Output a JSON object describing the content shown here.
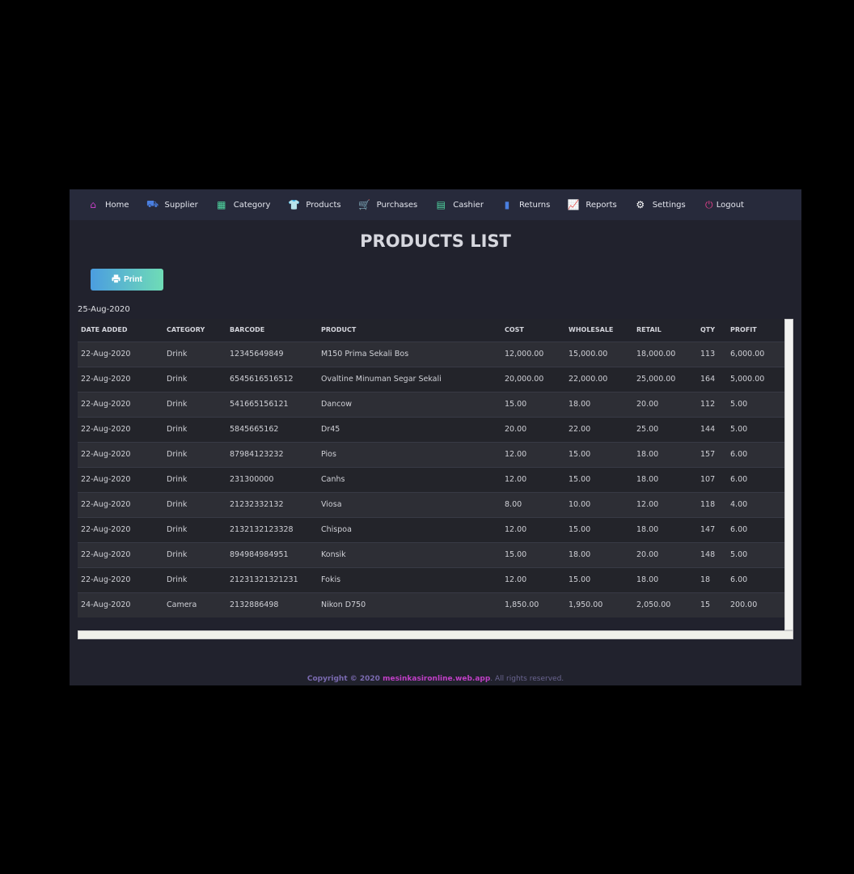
{
  "nav": {
    "items": [
      {
        "label": "Home",
        "icon": "home-icon",
        "color": "#c43fc4"
      },
      {
        "label": "Supplier",
        "icon": "truck-icon",
        "color": "#4a7fe0"
      },
      {
        "label": "Category",
        "icon": "boxes-icon",
        "color": "#4fd6a0"
      },
      {
        "label": "Products",
        "icon": "tshirt-icon",
        "color": "#ffffff"
      },
      {
        "label": "Purchases",
        "icon": "cart-icon",
        "color": "#e0408a"
      },
      {
        "label": "Cashier",
        "icon": "cash-register-icon",
        "color": "#4fd6a0"
      },
      {
        "label": "Returns",
        "icon": "receipt-icon",
        "color": "#4a7fe0"
      },
      {
        "label": "Reports",
        "icon": "chart-line-icon",
        "color": "#e05a6a"
      },
      {
        "label": "Settings",
        "icon": "gear-icon",
        "color": "#ffffff"
      },
      {
        "label": "Logout",
        "icon": "power-icon",
        "color": "#e0408a"
      }
    ]
  },
  "page": {
    "title": "PRODUCTS LIST",
    "print_label": "Print",
    "date": "25-Aug-2020"
  },
  "table": {
    "headers": [
      "DATE ADDED",
      "CATEGORY",
      "BARCODE",
      "PRODUCT",
      "COST",
      "WHOLESALE",
      "RETAIL",
      "QTY",
      "PROFIT"
    ],
    "rows": [
      [
        "22-Aug-2020",
        "Drink",
        "12345649849",
        "M150 Prima Sekali Bos",
        "12,000.00",
        "15,000.00",
        "18,000.00",
        "113",
        "6,000.00"
      ],
      [
        "22-Aug-2020",
        "Drink",
        "6545616516512",
        "Ovaltine Minuman Segar Sekali",
        "20,000.00",
        "22,000.00",
        "25,000.00",
        "164",
        "5,000.00"
      ],
      [
        "22-Aug-2020",
        "Drink",
        "541665156121",
        "Dancow",
        "15.00",
        "18.00",
        "20.00",
        "112",
        "5.00"
      ],
      [
        "22-Aug-2020",
        "Drink",
        "5845665162",
        "Dr45",
        "20.00",
        "22.00",
        "25.00",
        "144",
        "5.00"
      ],
      [
        "22-Aug-2020",
        "Drink",
        "87984123232",
        "Pios",
        "12.00",
        "15.00",
        "18.00",
        "157",
        "6.00"
      ],
      [
        "22-Aug-2020",
        "Drink",
        "231300000",
        "Canhs",
        "12.00",
        "15.00",
        "18.00",
        "107",
        "6.00"
      ],
      [
        "22-Aug-2020",
        "Drink",
        "21232332132",
        "Viosa",
        "8.00",
        "10.00",
        "12.00",
        "118",
        "4.00"
      ],
      [
        "22-Aug-2020",
        "Drink",
        "2132132123328",
        "Chispoa",
        "12.00",
        "15.00",
        "18.00",
        "147",
        "6.00"
      ],
      [
        "22-Aug-2020",
        "Drink",
        "894984984951",
        "Konsik",
        "15.00",
        "18.00",
        "20.00",
        "148",
        "5.00"
      ],
      [
        "22-Aug-2020",
        "Drink",
        "21231321321231",
        "Fokis",
        "12.00",
        "15.00",
        "18.00",
        "18",
        "6.00"
      ],
      [
        "24-Aug-2020",
        "Camera",
        "2132886498",
        "Nikon D750",
        "1,850.00",
        "1,950.00",
        "2,050.00",
        "15",
        "200.00"
      ]
    ]
  },
  "footer": {
    "prefix": "Copyright © 2020 ",
    "brand": "mesinkasironline.web.app",
    "suffix": ". All rights reserved."
  }
}
